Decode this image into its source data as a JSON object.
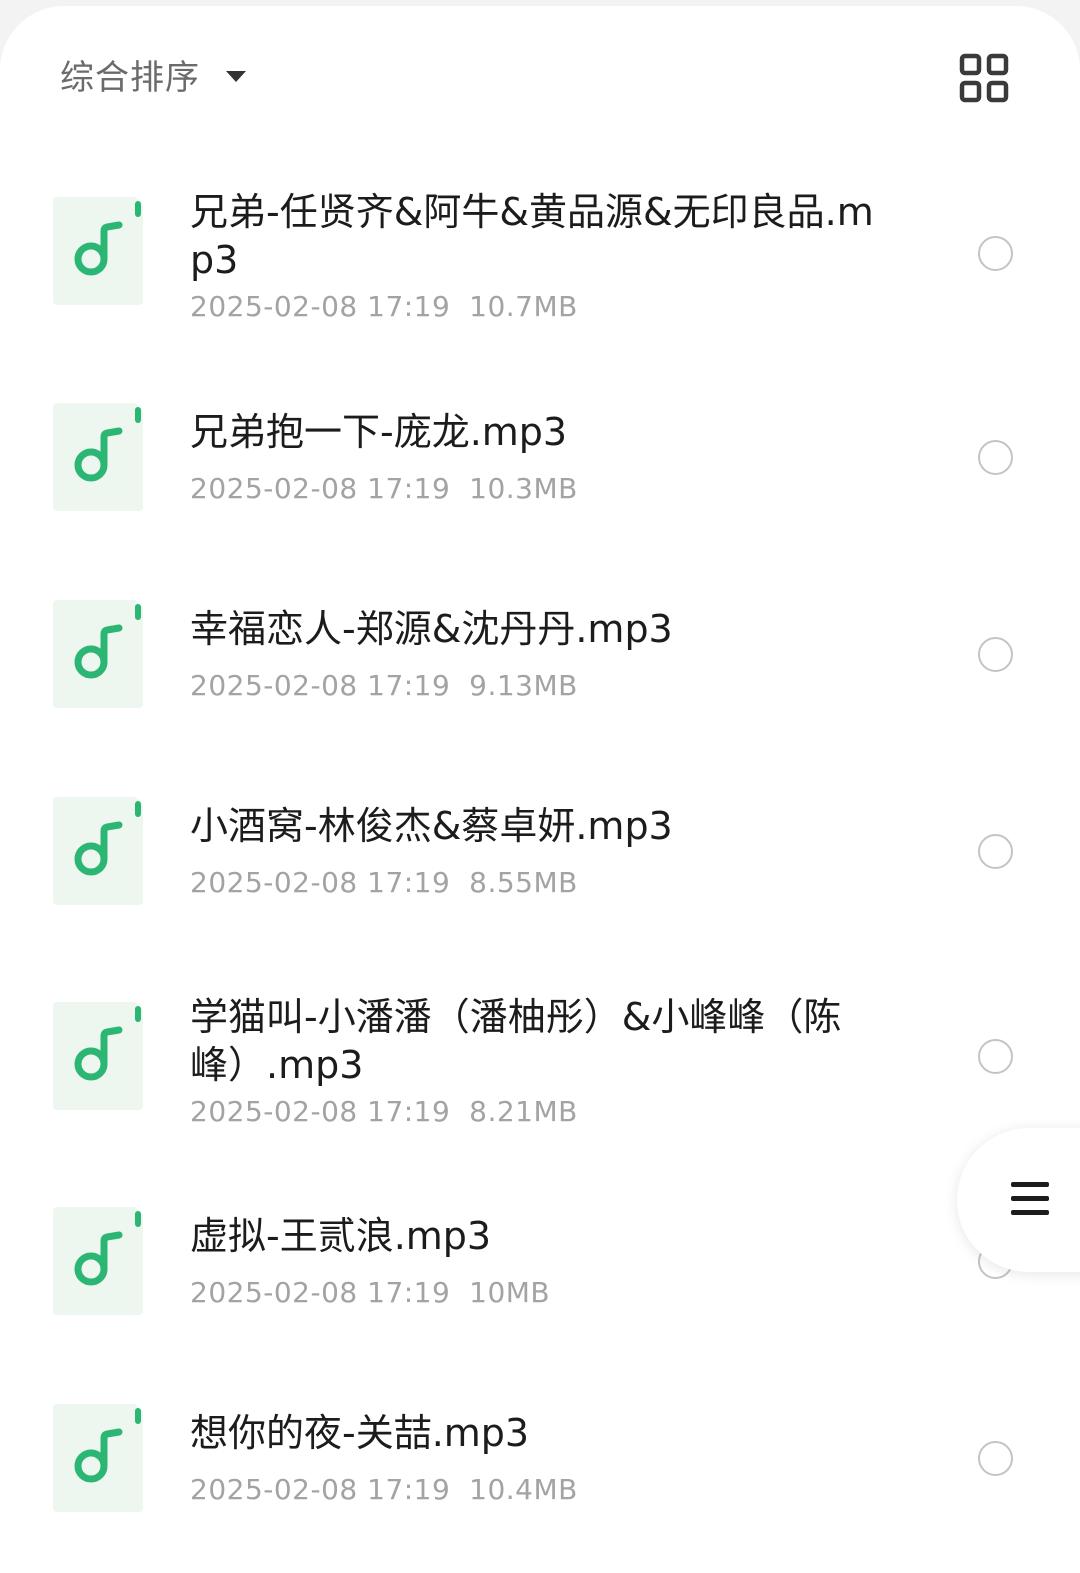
{
  "toolbar": {
    "sort_label": "综合排序",
    "sort_caret_icon": "caret-down-icon",
    "view_toggle_icon": "grid-view-icon"
  },
  "colors": {
    "accent_green": "#2bb673",
    "icon_bg": "#eef6f0",
    "title_text": "#1c1c1c",
    "meta_text": "#a3a3a3"
  },
  "files": [
    {
      "name": "兄弟-任贤齐&阿牛&黄品源&无印良品.mp3",
      "date": "2025-02-08 17:19",
      "size": "10.7MB",
      "icon": "music-file-icon"
    },
    {
      "name": "兄弟抱一下-庞龙.mp3",
      "date": "2025-02-08 17:19",
      "size": "10.3MB",
      "icon": "music-file-icon"
    },
    {
      "name": "幸福恋人-郑源&沈丹丹.mp3",
      "date": "2025-02-08 17:19",
      "size": "9.13MB",
      "icon": "music-file-icon"
    },
    {
      "name": "小酒窝-林俊杰&蔡卓妍.mp3",
      "date": "2025-02-08 17:19",
      "size": "8.55MB",
      "icon": "music-file-icon"
    },
    {
      "name": "学猫叫-小潘潘（潘柚彤）&小峰峰（陈峰）.mp3",
      "date": "2025-02-08 17:19",
      "size": "8.21MB",
      "icon": "music-file-icon"
    },
    {
      "name": "虚拟-王贰浪.mp3",
      "date": "2025-02-08 17:19",
      "size": "10MB",
      "icon": "music-file-icon"
    },
    {
      "name": "想你的夜-关喆.mp3",
      "date": "2025-02-08 17:19",
      "size": "10.4MB",
      "icon": "music-file-icon"
    }
  ],
  "floating_menu": {
    "icon": "menu-icon"
  }
}
